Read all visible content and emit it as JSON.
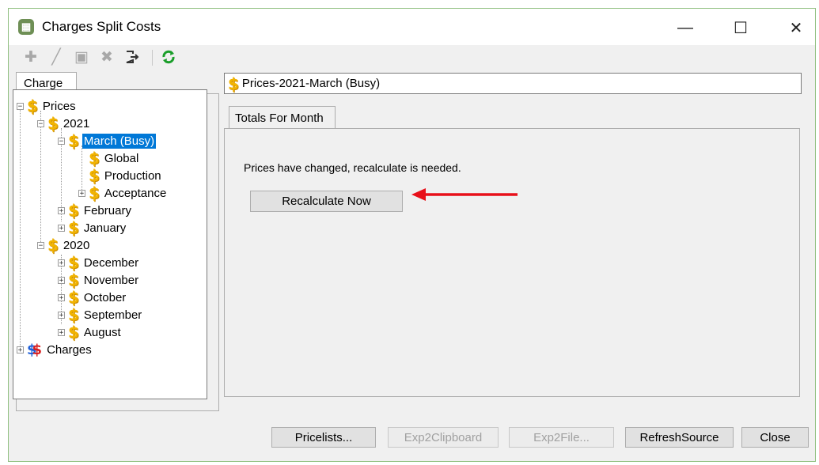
{
  "window": {
    "title": "Charges Split Costs",
    "app_icon": "calculator-icon",
    "controls": [
      "minimize-icon",
      "maximize-icon",
      "close-icon"
    ]
  },
  "toolbar": {
    "buttons": [
      {
        "name": "add-icon",
        "enabled": false
      },
      {
        "name": "edit-icon",
        "enabled": false
      },
      {
        "name": "save-icon",
        "enabled": false
      },
      {
        "name": "delete-icon",
        "enabled": false
      },
      {
        "name": "exit-icon",
        "enabled": true
      },
      {
        "name": "refresh-icon",
        "enabled": true
      }
    ]
  },
  "left_panel": {
    "tab_label": "Charge",
    "tree": {
      "prices": "Prices",
      "y2021": "2021",
      "march": "March (Busy)",
      "global": "Global",
      "production": "Production",
      "acceptance": "Acceptance",
      "february": "February",
      "january": "January",
      "y2020": "2020",
      "december": "December",
      "november": "November",
      "october": "October",
      "september": "September",
      "august": "August",
      "charges": "Charges"
    }
  },
  "right_panel": {
    "path": "Prices-2021-March (Busy)",
    "tab_label": "Totals For Month",
    "message": "Prices have changed, recalculate is needed.",
    "recalc_label": "Recalculate Now"
  },
  "bottom_buttons": {
    "pricelists": "Pricelists...",
    "exp2clipboard": "Exp2Clipboard",
    "exp2file": "Exp2File...",
    "refreshsource": "RefreshSource",
    "close": "Close"
  },
  "colors": {
    "selection": "#0078d7",
    "dollar_icon": "#f2b400",
    "annotation_arrow": "#e8101a"
  }
}
